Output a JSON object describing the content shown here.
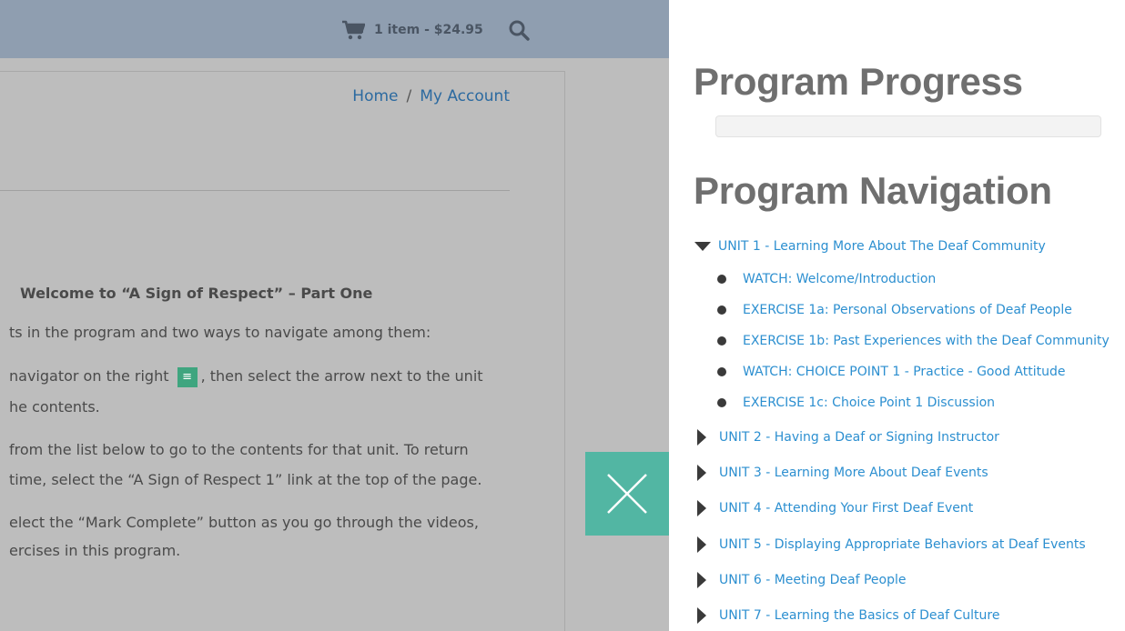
{
  "header": {
    "cart_text": "1 item - $24.95",
    "cart_icon": "shopping-cart-icon",
    "search_icon": "search-icon"
  },
  "breadcrumb": {
    "home": "Home",
    "separator": "/",
    "account": "My Account"
  },
  "content": {
    "welcome": "Welcome to “A Sign of Respect” – Part One",
    "line1": "ts in the program and two ways to navigate among them:",
    "line2a": "navigator on the right",
    "line2b": ", then select the arrow next to the unit",
    "line3": "he contents.",
    "line4": "from the list below to go to the contents for that unit.  To return",
    "line5": "time, select the “A Sign of Respect 1” link at the top of the page.",
    "line6": "elect the “Mark Complete” button as you go through the videos,",
    "line7": "ercises in this program."
  },
  "sidebar": {
    "progress_title": "Program Progress",
    "progress_percent": 0,
    "navigation_title": "Program Navigation",
    "units": [
      {
        "label": "UNIT 1 - Learning More About The Deaf Community",
        "expanded": true,
        "lessons": [
          "WATCH: Welcome/Introduction",
          "EXERCISE 1a: Personal Observations of Deaf People",
          "EXERCISE 1b: Past Experiences with the Deaf Community",
          "WATCH: CHOICE POINT 1 - Practice - Good Attitude",
          "EXERCISE 1c: Choice Point 1 Discussion"
        ]
      },
      {
        "label": "UNIT 2 - Having a Deaf or Signing Instructor",
        "expanded": false
      },
      {
        "label": "UNIT 3 - Learning More About Deaf Events",
        "expanded": false
      },
      {
        "label": "UNIT 4 - Attending Your First Deaf Event",
        "expanded": false
      },
      {
        "label": "UNIT 5 - Displaying Appropriate Behaviors at Deaf Events",
        "expanded": false
      },
      {
        "label": "UNIT 6 - Meeting Deaf People",
        "expanded": false
      },
      {
        "label": "UNIT 7 - Learning the Basics of Deaf Culture",
        "expanded": false
      }
    ]
  },
  "colors": {
    "accent": "#52b6a3",
    "link": "#2c8fd0",
    "topbar": "#8f9eb0",
    "overlay": "#bdbdbd"
  }
}
